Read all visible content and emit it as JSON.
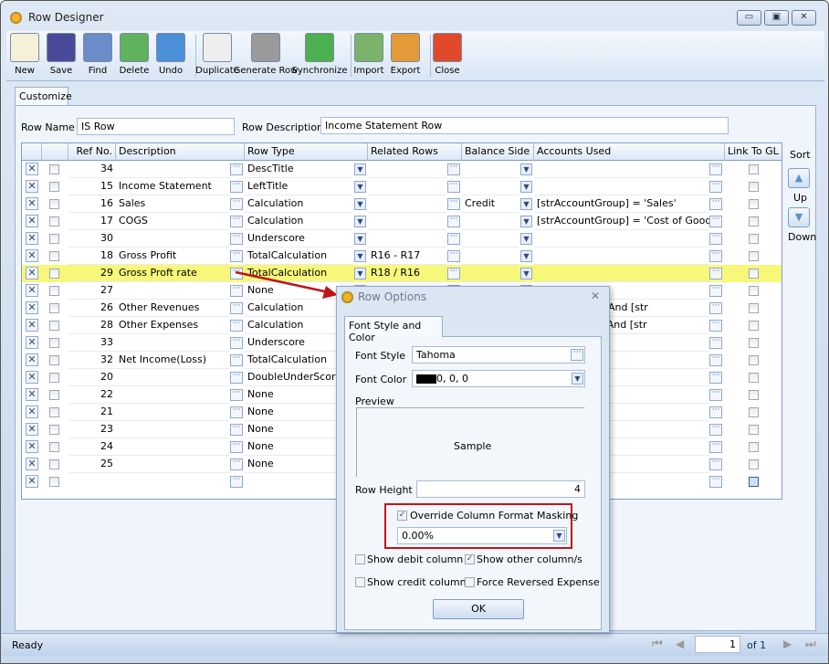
{
  "window": {
    "title": "Row Designer",
    "minimize": "▭",
    "restore": "▣",
    "close": "✕"
  },
  "toolbar": [
    {
      "label": "New",
      "icon": "new-document-icon",
      "color": "#f5f0d8"
    },
    {
      "label": "Save",
      "icon": "floppy-disk-icon",
      "color": "#4a4a9a"
    },
    {
      "label": "Find",
      "icon": "binoculars-icon",
      "color": "#6a8cc8"
    },
    {
      "label": "Delete",
      "icon": "recycle-bin-icon",
      "color": "#5fb35f"
    },
    {
      "label": "Undo",
      "icon": "undo-arrow-icon",
      "color": "#4a8fd8"
    },
    {
      "label": "Duplicate",
      "icon": "duplicate-icon",
      "color": "#eeeeee"
    },
    {
      "label": "Generate Row",
      "icon": "gear-icon",
      "color": "#9a9a9a"
    },
    {
      "label": "Synchronize",
      "icon": "synchronize-icon",
      "color": "#4caf50"
    },
    {
      "label": "Import",
      "icon": "import-icon",
      "color": "#7cb36a"
    },
    {
      "label": "Export",
      "icon": "export-icon",
      "color": "#e59a3a"
    },
    {
      "label": "Close",
      "icon": "close-window-icon",
      "color": "#e04a2a"
    }
  ],
  "tab": "Customize",
  "form": {
    "row_name_label": "Row Name",
    "row_name": "IS Row",
    "row_desc_label": "Row Description",
    "row_desc": "Income Statement Row"
  },
  "grid": {
    "columns": [
      "Ref No.",
      "Description",
      "Row Type",
      "Related Rows",
      "Balance Side",
      "Accounts Used",
      "Link To GL"
    ],
    "rows": [
      {
        "ref": "34",
        "desc": "",
        "type": "DescTitle",
        "related": "",
        "balance": "",
        "accounts": ""
      },
      {
        "ref": "15",
        "desc": "Income Statement",
        "type": "LeftTitle",
        "related": "",
        "balance": "",
        "accounts": ""
      },
      {
        "ref": "16",
        "desc": "Sales",
        "type": "Calculation",
        "related": "",
        "balance": "Credit",
        "accounts": "[strAccountGroup]  = 'Sales'"
      },
      {
        "ref": "17",
        "desc": "COGS",
        "type": "Calculation",
        "related": "",
        "balance": "",
        "accounts": "[strAccountGroup]  = 'Cost of Goods So"
      },
      {
        "ref": "30",
        "desc": "",
        "type": "Underscore",
        "related": "",
        "balance": "",
        "accounts": ""
      },
      {
        "ref": "18",
        "desc": "Gross Profit",
        "type": "TotalCalculation",
        "related": "R16 - R17",
        "balance": "",
        "accounts": ""
      },
      {
        "ref": "29",
        "desc": "Gross Proft rate",
        "type": "TotalCalculation",
        "related": "R18 / R16",
        "balance": "",
        "accounts": "",
        "selected": true
      },
      {
        "ref": "27",
        "desc": "",
        "type": "None",
        "related": "",
        "balance": "",
        "accounts": ""
      },
      {
        "ref": "26",
        "desc": "Other Revenues",
        "type": "Calculation",
        "related": "",
        "balance": "",
        "accounts": "] = 'Revenue' And [str"
      },
      {
        "ref": "28",
        "desc": "Other Expenses",
        "type": "Calculation",
        "related": "",
        "balance": "",
        "accounts": "] = 'Expense' And [str"
      },
      {
        "ref": "33",
        "desc": "",
        "type": "Underscore",
        "related": "",
        "balance": "",
        "accounts": ""
      },
      {
        "ref": "32",
        "desc": "Net Income(Loss)",
        "type": "TotalCalculation",
        "related": "",
        "balance": "",
        "accounts": ""
      },
      {
        "ref": "20",
        "desc": "",
        "type": "DoubleUnderScore",
        "related": "",
        "balance": "",
        "accounts": ""
      },
      {
        "ref": "22",
        "desc": "",
        "type": "None",
        "related": "",
        "balance": "",
        "accounts": ""
      },
      {
        "ref": "21",
        "desc": "",
        "type": "None",
        "related": "",
        "balance": "",
        "accounts": ""
      },
      {
        "ref": "23",
        "desc": "",
        "type": "None",
        "related": "",
        "balance": "",
        "accounts": ""
      },
      {
        "ref": "24",
        "desc": "",
        "type": "None",
        "related": "",
        "balance": "",
        "accounts": ""
      },
      {
        "ref": "25",
        "desc": "",
        "type": "None",
        "related": "",
        "balance": "",
        "accounts": ""
      }
    ]
  },
  "sort": {
    "label": "Sort",
    "up": "Up",
    "down": "Down"
  },
  "status": {
    "text": "Ready",
    "page": "1",
    "of_label": "of 1"
  },
  "dialog": {
    "title": "Row Options",
    "close": "✕",
    "tab": "Font Style and Color",
    "font_style_label": "Font Style",
    "font_style": "Tahoma",
    "font_color_label": "Font Color",
    "font_color": "0, 0, 0",
    "font_color_swatch": "#000000",
    "preview_label": "Preview",
    "preview_text": "Sample",
    "row_height_label": "Row Height",
    "row_height": "4",
    "override_label": "Override Column Format Masking",
    "override_checked": true,
    "mask": "0.00%",
    "show_debit": "Show debit column",
    "show_debit_checked": false,
    "show_other": "Show other column/s",
    "show_other_checked": true,
    "show_credit": "Show credit column",
    "show_credit_checked": false,
    "force_reversed": "Force Reversed Expense",
    "force_reversed_checked": false,
    "ok": "OK"
  },
  "colors": {
    "selected_row": "#f7f77a",
    "highlight_box": "#c0141c",
    "arrow": "#c0141c"
  }
}
